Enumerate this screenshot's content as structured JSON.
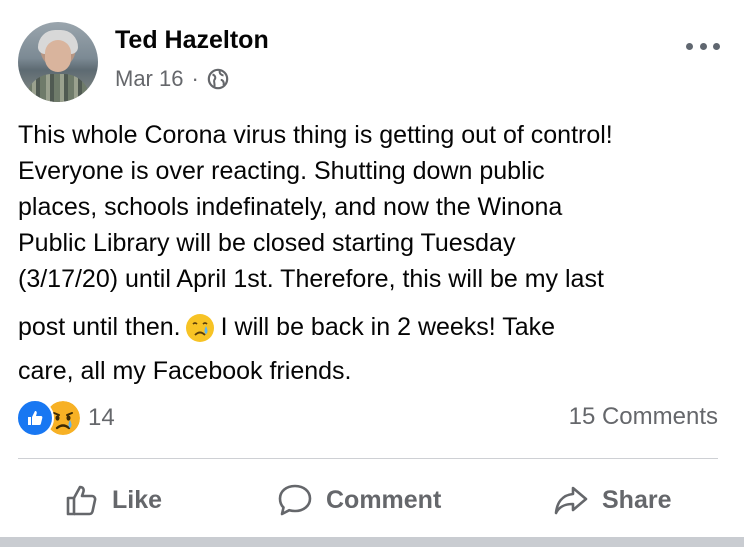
{
  "post": {
    "author": "Ted Hazelton",
    "date": "Mar 16",
    "separator": "·",
    "privacy_icon": "globe-icon",
    "lines": [
      "This whole Corona virus thing is getting out of control!",
      "Everyone is over reacting. Shutting down public",
      "places, schools indefinately, and now the Winona",
      "Public Library will be closed starting Tuesday",
      "(3/17/20) until April 1st. Therefore, this will be my last"
    ],
    "line6_before_emoji": "post until then.",
    "inline_emoji": "crying-face-emoji",
    "line6_after_emoji": "I will be back in 2 weeks! Take",
    "line7": "care, all my Facebook friends."
  },
  "reactions": {
    "icons": [
      "like-reaction-icon",
      "sad-reaction-icon"
    ],
    "count": "14",
    "comments": "15 Comments"
  },
  "actions": {
    "like": "Like",
    "comment": "Comment",
    "share": "Share"
  },
  "colors": {
    "text": "#050505",
    "secondary": "#65676b",
    "like_blue": "#1877f2",
    "emoji_yellow": "#f7b125"
  }
}
